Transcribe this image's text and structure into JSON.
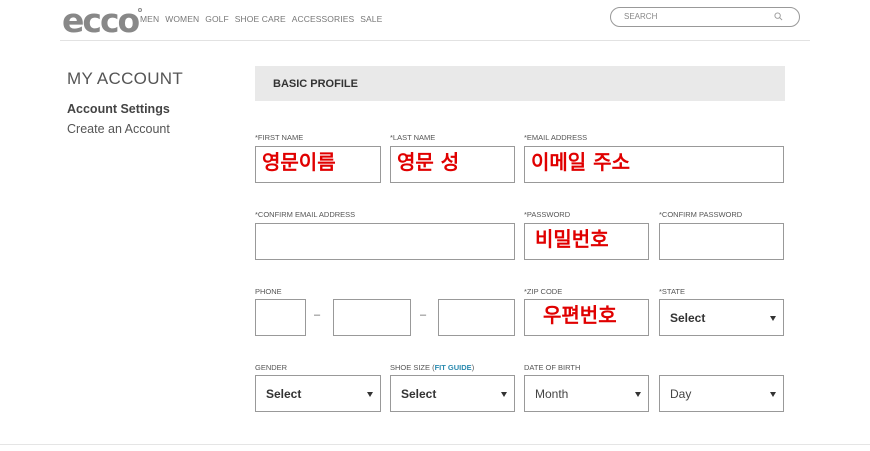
{
  "header": {
    "logo": "ecco",
    "nav": [
      "MEN",
      "WOMEN",
      "GOLF",
      "SHOE CARE",
      "ACCESSORIES",
      "SALE"
    ],
    "search_placeholder": "SEARCH"
  },
  "sidebar": {
    "title": "MY ACCOUNT",
    "active_item": "Account Settings",
    "link_item": "Create an Account"
  },
  "form": {
    "section_title": "BASIC PROFILE",
    "first_name": {
      "label": "*FIRST NAME",
      "value": "영문이름"
    },
    "last_name": {
      "label": "*LAST NAME",
      "value": "영문 성"
    },
    "email": {
      "label": "*EMAIL ADDRESS",
      "value": "이메일 주소"
    },
    "confirm_email": {
      "label": "*CONFIRM EMAIL ADDRESS",
      "value": ""
    },
    "password": {
      "label": "*PASSWORD",
      "value": "비밀번호"
    },
    "confirm_password": {
      "label": "*CONFIRM PASSWORD",
      "value": ""
    },
    "phone": {
      "label": "PHONE",
      "separator": "–"
    },
    "zip": {
      "label": "*ZIP CODE",
      "value": "우편번호"
    },
    "state": {
      "label": "*STATE",
      "value": "Select"
    },
    "gender": {
      "label": "GENDER",
      "value": "Select"
    },
    "shoe_size": {
      "label": "SHOE SIZE (",
      "link": "FIT GUIDE",
      "label_end": ")",
      "value": "Select"
    },
    "dob": {
      "label": "DATE OF BIRTH",
      "month": "Month",
      "day": "Day"
    }
  }
}
